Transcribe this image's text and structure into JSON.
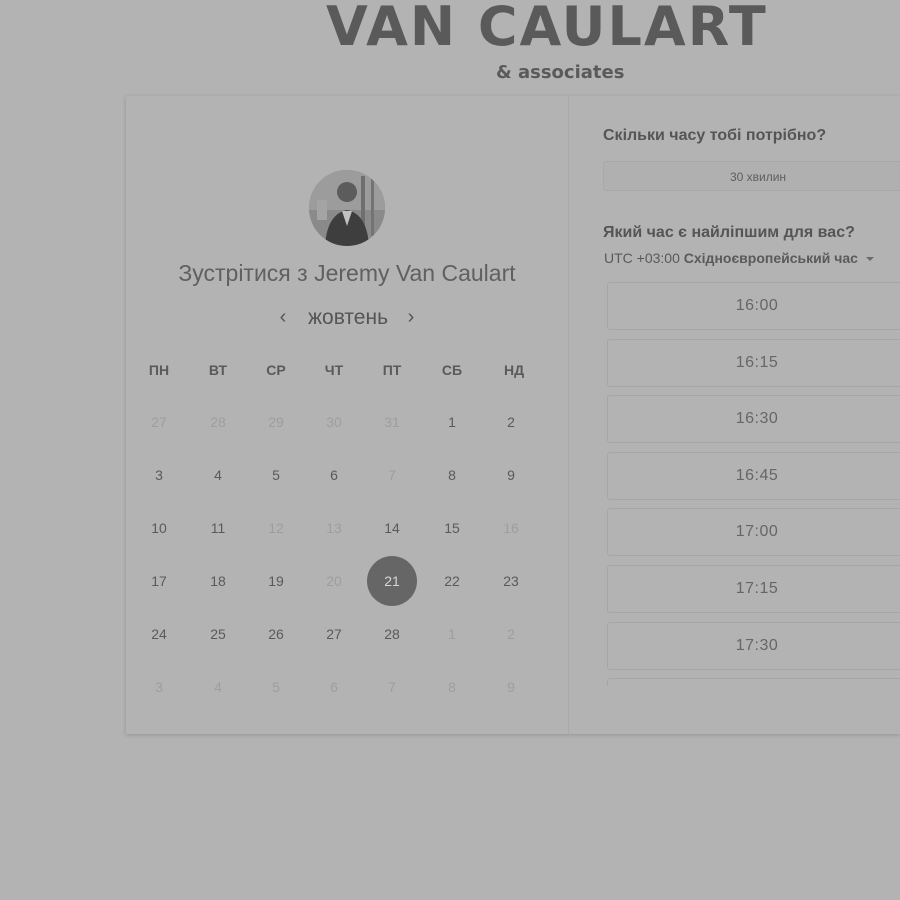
{
  "brand": {
    "name": "VAN CAULART",
    "subtitle": "& associates"
  },
  "left": {
    "heading_prefix": "Зустрітися з ",
    "heading_name": "Jeremy Van Caulart",
    "month": "жовтень",
    "prev_icon": "chevron-left-icon",
    "next_icon": "chevron-right-icon",
    "weekdays": [
      "ПН",
      "ВТ",
      "СР",
      "ЧТ",
      "ПТ",
      "СБ",
      "НД"
    ],
    "weeks": [
      [
        {
          "d": "27",
          "muted": true
        },
        {
          "d": "28",
          "muted": true
        },
        {
          "d": "29",
          "muted": true
        },
        {
          "d": "30",
          "muted": true
        },
        {
          "d": "31",
          "muted": true
        },
        {
          "d": "1",
          "muted": false
        },
        {
          "d": "2",
          "muted": false
        }
      ],
      [
        {
          "d": "3",
          "muted": false
        },
        {
          "d": "4",
          "muted": false
        },
        {
          "d": "5",
          "muted": false
        },
        {
          "d": "6",
          "muted": false
        },
        {
          "d": "7",
          "muted": true
        },
        {
          "d": "8",
          "muted": false
        },
        {
          "d": "9",
          "muted": false
        }
      ],
      [
        {
          "d": "10",
          "muted": false
        },
        {
          "d": "11",
          "muted": false
        },
        {
          "d": "12",
          "muted": true
        },
        {
          "d": "13",
          "muted": true
        },
        {
          "d": "14",
          "muted": false
        },
        {
          "d": "15",
          "muted": false
        },
        {
          "d": "16",
          "muted": true
        }
      ],
      [
        {
          "d": "17",
          "muted": false
        },
        {
          "d": "18",
          "muted": false
        },
        {
          "d": "19",
          "muted": false
        },
        {
          "d": "20",
          "muted": true
        },
        {
          "d": "21",
          "muted": false,
          "selected": true
        },
        {
          "d": "22",
          "muted": false
        },
        {
          "d": "23",
          "muted": false
        }
      ],
      [
        {
          "d": "24",
          "muted": false
        },
        {
          "d": "25",
          "muted": false
        },
        {
          "d": "26",
          "muted": false
        },
        {
          "d": "27",
          "muted": false
        },
        {
          "d": "28",
          "muted": false
        },
        {
          "d": "1",
          "muted": true
        },
        {
          "d": "2",
          "muted": true
        }
      ],
      [
        {
          "d": "3",
          "muted": true
        },
        {
          "d": "4",
          "muted": true
        },
        {
          "d": "5",
          "muted": true
        },
        {
          "d": "6",
          "muted": true
        },
        {
          "d": "7",
          "muted": true
        },
        {
          "d": "8",
          "muted": true
        },
        {
          "d": "9",
          "muted": true
        }
      ]
    ]
  },
  "right": {
    "duration_question": "Скільки часу тобі потрібно?",
    "duration_value": "30 хвилин",
    "time_question": "Який час є найліпшим для вас?",
    "timezone_offset": "UTC +03:00 ",
    "timezone_name": "Східноєвропейський час",
    "time_slots": [
      "16:00",
      "16:15",
      "16:30",
      "16:45",
      "17:00",
      "17:15",
      "17:30"
    ]
  },
  "colors": {
    "background": "#b3b3b3",
    "selected_day": "#666666",
    "text": "#555555",
    "muted_text": "#9e9e9e"
  }
}
